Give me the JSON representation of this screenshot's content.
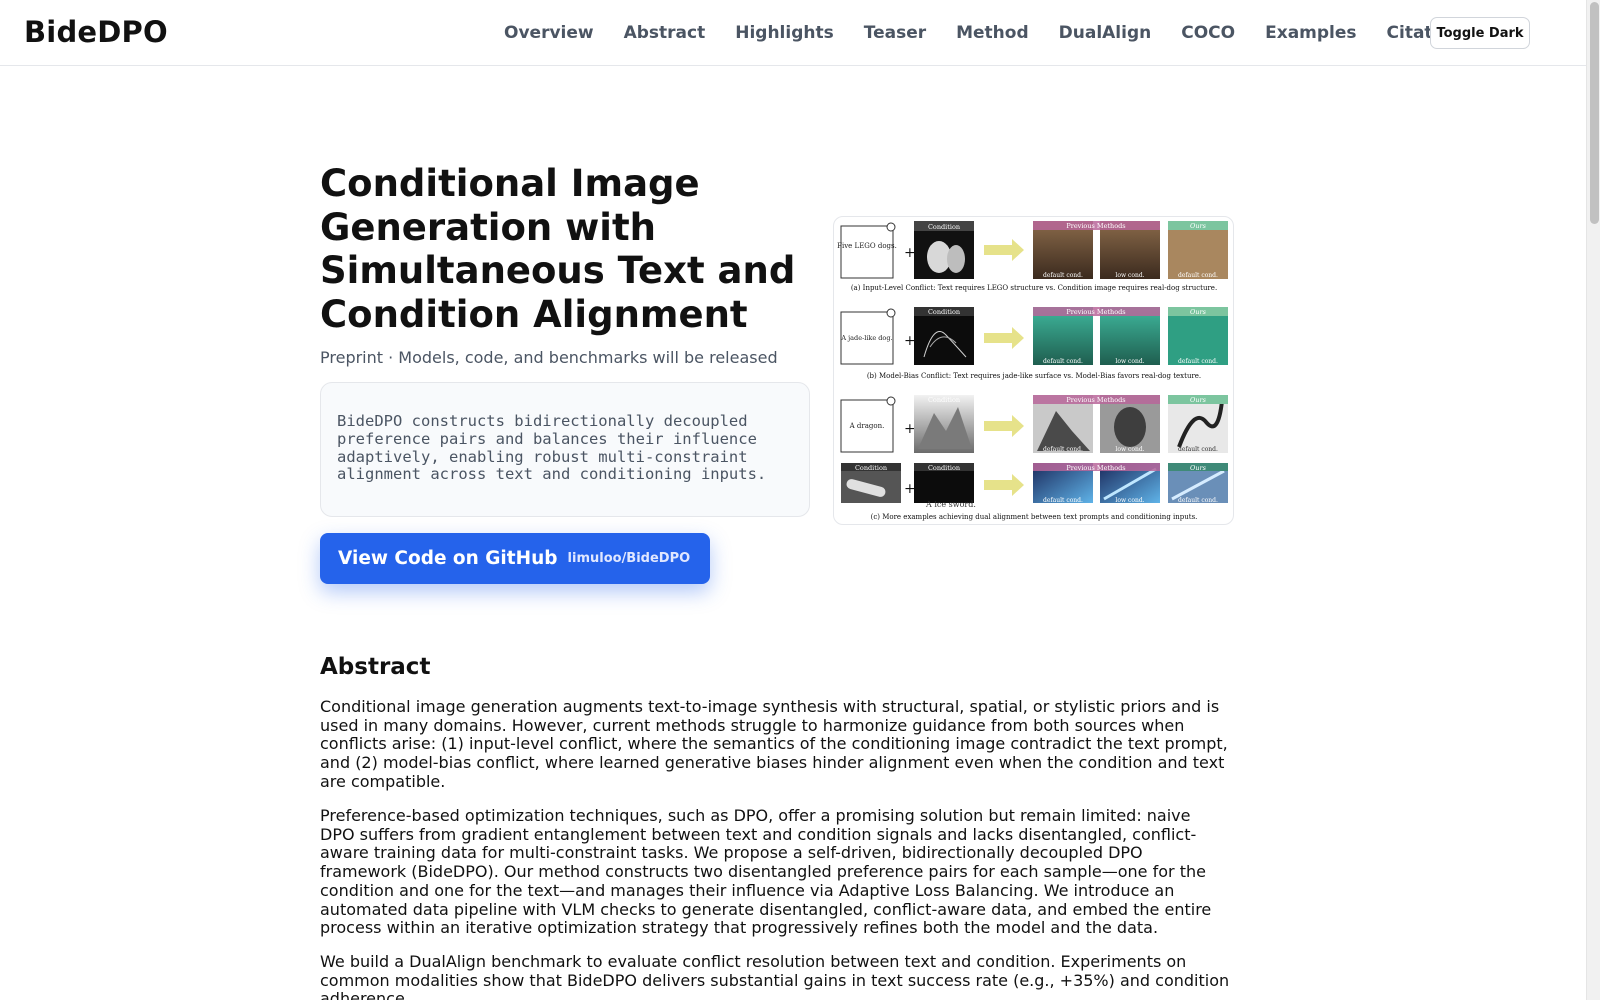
{
  "header": {
    "brand": "BideDPO",
    "nav": [
      "Overview",
      "Abstract",
      "Highlights",
      "Teaser",
      "Method",
      "DualAlign",
      "COCO",
      "Examples",
      "Citation"
    ],
    "toggle_label": "Toggle Dark"
  },
  "hero": {
    "title": "Conditional Image Generation with Simultaneous Text and Condition Alignment",
    "subtitle": "Preprint · Models, code, and benchmarks will be released",
    "summary": "BideDPO constructs bidirectionally decoupled preference pairs and balances their influence adaptively, enabling robust multi-constraint alignment across text and conditioning inputs.",
    "github_label": "View Code on GitHub",
    "github_repo": "limuloo/BideDPO"
  },
  "teaser": {
    "rows": [
      {
        "prompt": "Five LEGO dogs.",
        "caption": "(a) Input-Level Conflict: Text requires LEGO structure vs. Condition image requires real-dog structure."
      },
      {
        "prompt": "A jade-like dog.",
        "caption": "(b) Model-Bias Conflict: Text requires jade-like surface vs. Model-Bias favors real-dog texture."
      },
      {
        "prompt": "A dragon.",
        "caption": ""
      },
      {
        "prompt": "A ice sword.",
        "caption": "(c) More examples achieving dual alignment between text prompts and conditioning inputs."
      }
    ],
    "condition_label": "Condition",
    "previous_label": "Previous Methods",
    "ours_label": "Ours",
    "default_cond": "default cond.",
    "low_cond": "low cond."
  },
  "abstract": {
    "heading": "Abstract",
    "p1": "Conditional image generation augments text-to-image synthesis with structural, spatial, or stylistic priors and is used in many domains. However, current methods struggle to harmonize guidance from both sources when conflicts arise: (1) input-level conflict, where the semantics of the conditioning image contradict the text prompt, and (2) model-bias conflict, where learned generative biases hinder alignment even when the condition and text are compatible.",
    "p2": "Preference-based optimization techniques, such as DPO, offer a promising solution but remain limited: naive DPO suffers from gradient entanglement between text and condition signals and lacks disentangled, conflict-aware training data for multi-constraint tasks. We propose a self-driven, bidirectionally decoupled DPO framework (BideDPO). Our method constructs two disentangled preference pairs for each sample—one for the condition and one for the text—and manages their influence via Adaptive Loss Balancing. We introduce an automated data pipeline with VLM checks to generate disentangled, conflict-aware data, and embed the entire process within an iterative optimization strategy that progressively refines both the model and the data.",
    "p3": "We build a DualAlign benchmark to evaluate conflict resolution between text and condition. Experiments on common modalities show that BideDPO delivers substantial gains in text success rate (e.g., +35%) and condition adherence."
  }
}
